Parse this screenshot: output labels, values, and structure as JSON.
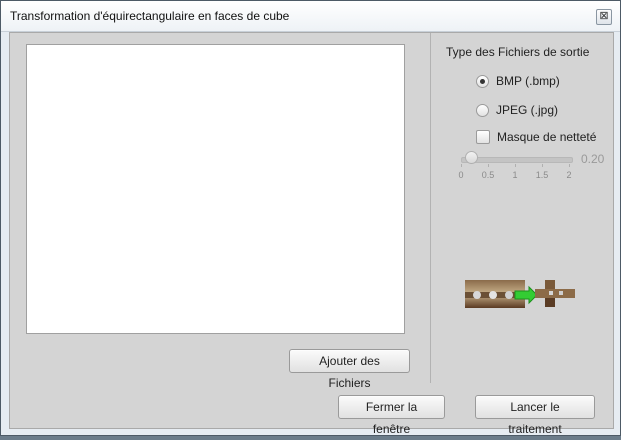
{
  "window": {
    "title": "Transformation d'équirectangulaire en faces de cube",
    "close_symbol": "⊠"
  },
  "file_panel": {
    "add_button_label": "Ajouter des Fichiers"
  },
  "options": {
    "section_title": "Type des Fichiers de sortie",
    "format_options": [
      {
        "label": "BMP (.bmp)",
        "selected": true
      },
      {
        "label": "JPEG (.jpg)",
        "selected": false
      }
    ],
    "sharpen_mask": {
      "label": "Masque de netteté",
      "checked": false,
      "value_text": "0.20",
      "value": 0.2,
      "enabled": false,
      "ticks": [
        "0",
        "0.5",
        "1",
        "1.5",
        "2"
      ]
    },
    "illustration_icon": "equirectangular-to-cube-icon"
  },
  "footer": {
    "close_button_label": "Fermer la fenêtre",
    "start_button_label": "Lancer le traitement"
  }
}
